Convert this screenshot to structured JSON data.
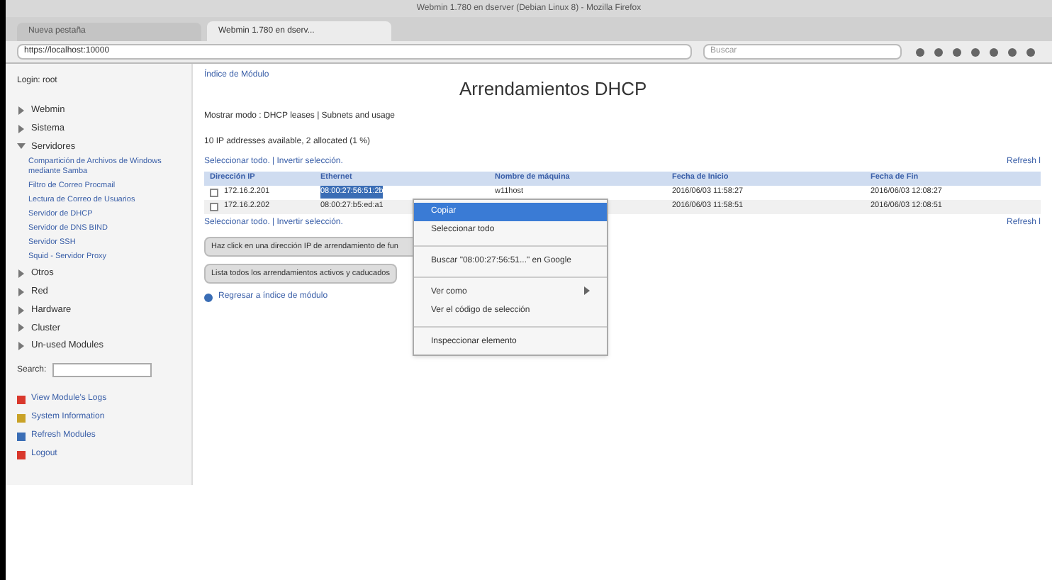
{
  "window": {
    "title": "Webmin 1.780 en dserver (Debian Linux 8) - Mozilla Firefox"
  },
  "tabs": [
    {
      "label": "Nueva pestaña",
      "selected": false
    },
    {
      "label": "Webmin 1.780 en dserv...",
      "selected": true
    }
  ],
  "address": {
    "value": "https://localhost:10000"
  },
  "search": {
    "placeholder": "Buscar"
  },
  "sidebar": {
    "login": "Login: root",
    "items": [
      {
        "label": "Webmin",
        "expanded": false
      },
      {
        "label": "Sistema",
        "expanded": false
      },
      {
        "label": "Servidores",
        "expanded": true,
        "children": [
          "Compartición de Archivos de Windows mediante Samba",
          "Filtro de Correo Procmail",
          "Lectura de Correo de Usuarios",
          "Servidor de DHCP",
          "Servidor de DNS BIND",
          "Servidor SSH",
          "Squid - Servidor Proxy"
        ]
      },
      {
        "label": "Otros",
        "expanded": false
      },
      {
        "label": "Red",
        "expanded": false
      },
      {
        "label": "Hardware",
        "expanded": false
      },
      {
        "label": "Cluster",
        "expanded": false
      },
      {
        "label": "Un-used Modules",
        "expanded": false
      }
    ],
    "search_label": "Search:",
    "links": [
      {
        "label": "View Module's Logs",
        "color": "#d9382c"
      },
      {
        "label": "System Information",
        "color": "#c9a227"
      },
      {
        "label": "Refresh Modules",
        "color": "#3a6db5"
      },
      {
        "label": "Logout",
        "color": "#d9382c"
      }
    ]
  },
  "main": {
    "module_index": "Índice de Módulo",
    "title": "Arrendamientos DHCP",
    "mode": "Mostrar modo : DHCP leases | Subnets and usage",
    "summary": "10 IP addresses available, 2 allocated (1 %)",
    "select_links": [
      "Seleccionar todo. | Invertir selección.",
      "Seleccionar todo. | Invertir selección."
    ],
    "refresh": [
      "Refresh l",
      "Refresh l"
    ],
    "table": {
      "columns": [
        "Dirección IP",
        "Ethernet",
        "Nombre de máquina",
        "Fecha de Inicio",
        "Fecha de Fin"
      ],
      "rows": [
        {
          "checked": false,
          "cells": [
            {
              "kind": "plain",
              "text": "172.16.2.201"
            },
            {
              "kind": "highlighted",
              "text": "08:00:27:56:51:2b"
            },
            {
              "kind": "plain",
              "text": "w11host"
            },
            {
              "kind": "plain",
              "text": "2016/06/03 11:58:27"
            },
            {
              "kind": "plain",
              "text": "2016/06/03 12:08:27"
            }
          ]
        },
        {
          "checked": false,
          "cells": [
            {
              "kind": "plain",
              "text": "172.16.2.202"
            },
            {
              "kind": "plain",
              "text": "08:00:27:b5:ed:a1"
            },
            {
              "kind": "empty"
            },
            {
              "kind": "plain",
              "text": "2016/06/03 11:58:51"
            },
            {
              "kind": "plain",
              "text": "2016/06/03 12:08:51"
            }
          ]
        }
      ]
    },
    "buttons": [
      "Haz click en una dirección IP de arrendamiento de fun",
      "Lista todos los arrendamientos activos y caducados"
    ],
    "back": "Regresar a índice de módulo"
  },
  "context_menu": [
    {
      "kind": "item",
      "label": "Copiar",
      "selected": true
    },
    {
      "kind": "item",
      "label": "Seleccionar todo",
      "selected": false
    },
    {
      "kind": "separator"
    },
    {
      "kind": "item",
      "label": "Buscar \"08:00:27:56:51...\" en Google",
      "selected": false
    },
    {
      "kind": "separator"
    },
    {
      "kind": "submenu",
      "label": "Ver como",
      "selected": false
    },
    {
      "kind": "item",
      "label": "Ver el código de selección",
      "selected": false
    },
    {
      "kind": "separator"
    },
    {
      "kind": "item",
      "label": "Inspeccionar elemento",
      "selected": false
    }
  ]
}
